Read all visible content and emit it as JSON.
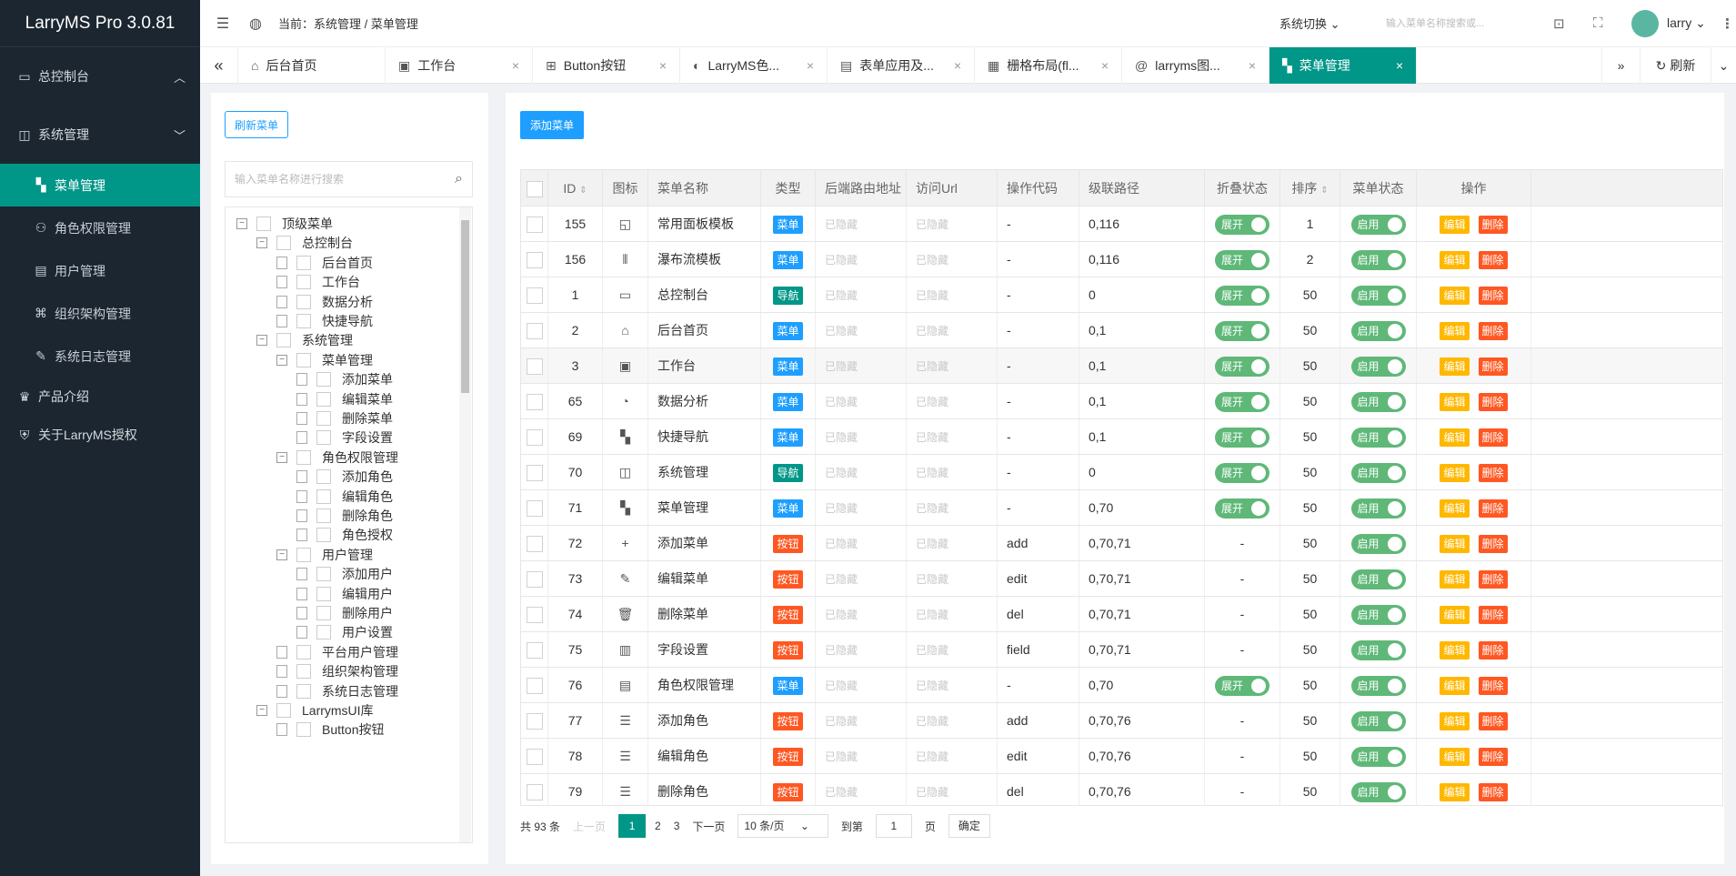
{
  "app": {
    "title": "LarryMS Pro 3.0.81"
  },
  "sidebar": {
    "groups": [
      {
        "label": "总控制台",
        "icon": "monitor-icon",
        "arrow": "︿"
      },
      {
        "label": "系统管理",
        "icon": "settings-monitor-icon",
        "arrow": "﹀"
      }
    ],
    "subitems": [
      {
        "label": "菜单管理",
        "icon": "grid-icon",
        "active": true
      },
      {
        "label": "角色权限管理",
        "icon": "user-role-icon"
      },
      {
        "label": "用户管理",
        "icon": "user-card-icon"
      },
      {
        "label": "组织架构管理",
        "icon": "org-icon"
      },
      {
        "label": "系统日志管理",
        "icon": "edit-log-icon"
      }
    ],
    "extra": [
      {
        "label": "产品介绍",
        "icon": "trophy-icon"
      },
      {
        "label": "关于LarryMS授权",
        "icon": "shield-icon"
      }
    ]
  },
  "header": {
    "breadcrumb": "当前：系统管理 / 菜单管理",
    "system_switch": "系统切换",
    "search_placeholder": "输入菜单名称搜索或...",
    "user": "larry"
  },
  "tabs": [
    {
      "label": "后台首页",
      "icon": "home-icon",
      "closable": false
    },
    {
      "label": "工作台",
      "icon": "dashboard-icon",
      "closable": true
    },
    {
      "label": "Button按钮",
      "icon": "button-icon",
      "closable": true
    },
    {
      "label": "LarryMS色...",
      "icon": "palette-icon",
      "closable": true
    },
    {
      "label": "表单应用及...",
      "icon": "form-icon",
      "closable": true
    },
    {
      "label": "栅格布局(fl...",
      "icon": "grid-layout-icon",
      "closable": true
    },
    {
      "label": "larryms图...",
      "icon": "at-icon",
      "closable": true
    },
    {
      "label": "菜单管理",
      "icon": "grid-icon",
      "closable": true,
      "active": true
    }
  ],
  "tabs_right": {
    "refresh": "刷新"
  },
  "left": {
    "refresh_button": "刷新菜单",
    "search_placeholder": "输入菜单名称进行搜索",
    "tree": [
      {
        "label": "顶级菜单",
        "level": 0,
        "type": "toggle"
      },
      {
        "label": "总控制台",
        "level": 1,
        "type": "toggle"
      },
      {
        "label": "后台首页",
        "level": 2,
        "type": "leaf"
      },
      {
        "label": "工作台",
        "level": 2,
        "type": "leaf"
      },
      {
        "label": "数据分析",
        "level": 2,
        "type": "leaf"
      },
      {
        "label": "快捷导航",
        "level": 2,
        "type": "leaf"
      },
      {
        "label": "系统管理",
        "level": 1,
        "type": "toggle"
      },
      {
        "label": "菜单管理",
        "level": 2,
        "type": "toggle"
      },
      {
        "label": "添加菜单",
        "level": 3,
        "type": "leaf"
      },
      {
        "label": "编辑菜单",
        "level": 3,
        "type": "leaf"
      },
      {
        "label": "删除菜单",
        "level": 3,
        "type": "leaf"
      },
      {
        "label": "字段设置",
        "level": 3,
        "type": "leaf"
      },
      {
        "label": "角色权限管理",
        "level": 2,
        "type": "toggle"
      },
      {
        "label": "添加角色",
        "level": 3,
        "type": "leaf"
      },
      {
        "label": "编辑角色",
        "level": 3,
        "type": "leaf"
      },
      {
        "label": "删除角色",
        "level": 3,
        "type": "leaf"
      },
      {
        "label": "角色授权",
        "level": 3,
        "type": "leaf"
      },
      {
        "label": "用户管理",
        "level": 2,
        "type": "toggle"
      },
      {
        "label": "添加用户",
        "level": 3,
        "type": "leaf"
      },
      {
        "label": "编辑用户",
        "level": 3,
        "type": "leaf"
      },
      {
        "label": "删除用户",
        "level": 3,
        "type": "leaf"
      },
      {
        "label": "用户设置",
        "level": 3,
        "type": "leaf"
      },
      {
        "label": "平台用户管理",
        "level": 2,
        "type": "leaf"
      },
      {
        "label": "组织架构管理",
        "level": 2,
        "type": "leaf"
      },
      {
        "label": "系统日志管理",
        "level": 2,
        "type": "leaf"
      },
      {
        "label": "LarrymsUI库",
        "level": 1,
        "type": "toggle"
      },
      {
        "label": "Button按钮",
        "level": 2,
        "type": "leaf"
      }
    ]
  },
  "main": {
    "add_button": "添加菜单",
    "columns": [
      "ID",
      "图标",
      "菜单名称",
      "类型",
      "后端路由地址",
      "访问Url",
      "操作代码",
      "级联路径",
      "折叠状态",
      "排序",
      "菜单状态",
      "操作"
    ],
    "hidden_text": "已隐藏",
    "switch_expand": "展开",
    "switch_enabled": "启用",
    "edit_label": "编辑",
    "delete_label": "删除",
    "rows": [
      {
        "id": "155",
        "icon": "◱",
        "name": "常用面板模板",
        "type": "菜单",
        "code": "-",
        "path": "0,116",
        "fold": "展开",
        "sort": "1"
      },
      {
        "id": "156",
        "icon": "⦀",
        "name": "瀑布流模板",
        "type": "菜单",
        "code": "-",
        "path": "0,116",
        "fold": "展开",
        "sort": "2"
      },
      {
        "id": "1",
        "icon": "▭",
        "name": "总控制台",
        "type": "导航",
        "code": "-",
        "path": "0",
        "fold": "展开",
        "sort": "50"
      },
      {
        "id": "2",
        "icon": "⌂",
        "name": "后台首页",
        "type": "菜单",
        "code": "-",
        "path": "0,1",
        "fold": "展开",
        "sort": "50"
      },
      {
        "id": "3",
        "icon": "▣",
        "name": "工作台",
        "type": "菜单",
        "code": "-",
        "path": "0,1",
        "fold": "展开",
        "sort": "50"
      },
      {
        "id": "65",
        "icon": "◔",
        "name": "数据分析",
        "type": "菜单",
        "code": "-",
        "path": "0,1",
        "fold": "展开",
        "sort": "50"
      },
      {
        "id": "69",
        "icon": "▚",
        "name": "快捷导航",
        "type": "菜单",
        "code": "-",
        "path": "0,1",
        "fold": "展开",
        "sort": "50"
      },
      {
        "id": "70",
        "icon": "◫",
        "name": "系统管理",
        "type": "导航",
        "code": "-",
        "path": "0",
        "fold": "展开",
        "sort": "50"
      },
      {
        "id": "71",
        "icon": "▚",
        "name": "菜单管理",
        "type": "菜单",
        "code": "-",
        "path": "0,70",
        "fold": "展开",
        "sort": "50"
      },
      {
        "id": "72",
        "icon": "+",
        "name": "添加菜单",
        "type": "按钮",
        "code": "add",
        "path": "0,70,71",
        "fold": "-",
        "sort": "50"
      },
      {
        "id": "73",
        "icon": "✎",
        "name": "编辑菜单",
        "type": "按钮",
        "code": "edit",
        "path": "0,70,71",
        "fold": "-",
        "sort": "50"
      },
      {
        "id": "74",
        "icon": "🗑",
        "name": "删除菜单",
        "type": "按钮",
        "code": "del",
        "path": "0,70,71",
        "fold": "-",
        "sort": "50"
      },
      {
        "id": "75",
        "icon": "▥",
        "name": "字段设置",
        "type": "按钮",
        "code": "field",
        "path": "0,70,71",
        "fold": "-",
        "sort": "50"
      },
      {
        "id": "76",
        "icon": "▤",
        "name": "角色权限管理",
        "type": "菜单",
        "code": "-",
        "path": "0,70",
        "fold": "展开",
        "sort": "50"
      },
      {
        "id": "77",
        "icon": "☰",
        "name": "添加角色",
        "type": "按钮",
        "code": "add",
        "path": "0,70,76",
        "fold": "-",
        "sort": "50"
      },
      {
        "id": "78",
        "icon": "☰",
        "name": "编辑角色",
        "type": "按钮",
        "code": "edit",
        "path": "0,70,76",
        "fold": "-",
        "sort": "50"
      },
      {
        "id": "79",
        "icon": "☰",
        "name": "删除角色",
        "type": "按钮",
        "code": "del",
        "path": "0,70,76",
        "fold": "-",
        "sort": "50"
      }
    ]
  },
  "pager": {
    "total": "共 93 条",
    "prev": "上一页",
    "pages": [
      "1",
      "2",
      "3"
    ],
    "current": "1",
    "next": "下一页",
    "per_page": "10 条/页",
    "goto": "到第",
    "goto_value": "1",
    "page_unit": "页",
    "confirm": "确定"
  }
}
